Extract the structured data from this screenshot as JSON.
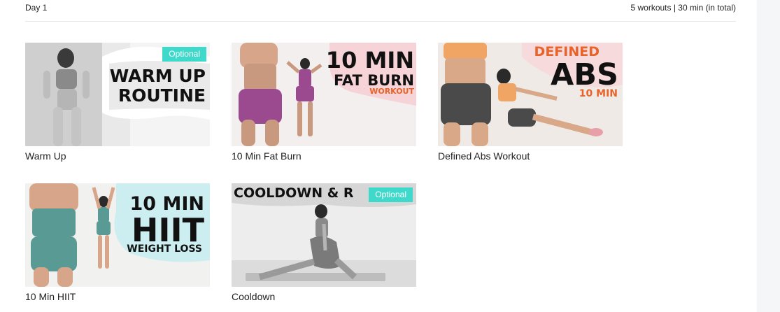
{
  "header": {
    "day_label": "Day 1",
    "summary": "5 workouts | 30 min (in total)"
  },
  "workouts": [
    {
      "title": "Warm Up",
      "badge": "Optional",
      "thumbnail_text": [
        "WARM UP",
        "ROUTINE"
      ]
    },
    {
      "title": "10 Min Fat Burn",
      "badge": "",
      "thumbnail_text": [
        "10 MIN",
        "FAT BURN",
        "WORKOUT"
      ]
    },
    {
      "title": "Defined Abs Workout",
      "badge": "",
      "thumbnail_text": [
        "DEFINED",
        "ABS",
        "10 MIN"
      ]
    },
    {
      "title": "10 Min HIIT",
      "badge": "",
      "thumbnail_text": [
        "10 MIN",
        "HIIT",
        "WEIGHT LOSS"
      ]
    },
    {
      "title": "Cooldown",
      "badge": "Optional",
      "thumbnail_text": [
        "COOLDOWN & R"
      ]
    }
  ],
  "colors": {
    "badge": "#3fd9cc",
    "accent_orange": "#e8632a",
    "purple_outfit": "#9b4a8f",
    "teal_outfit": "#5a9a94",
    "orange_top": "#f0a565"
  }
}
